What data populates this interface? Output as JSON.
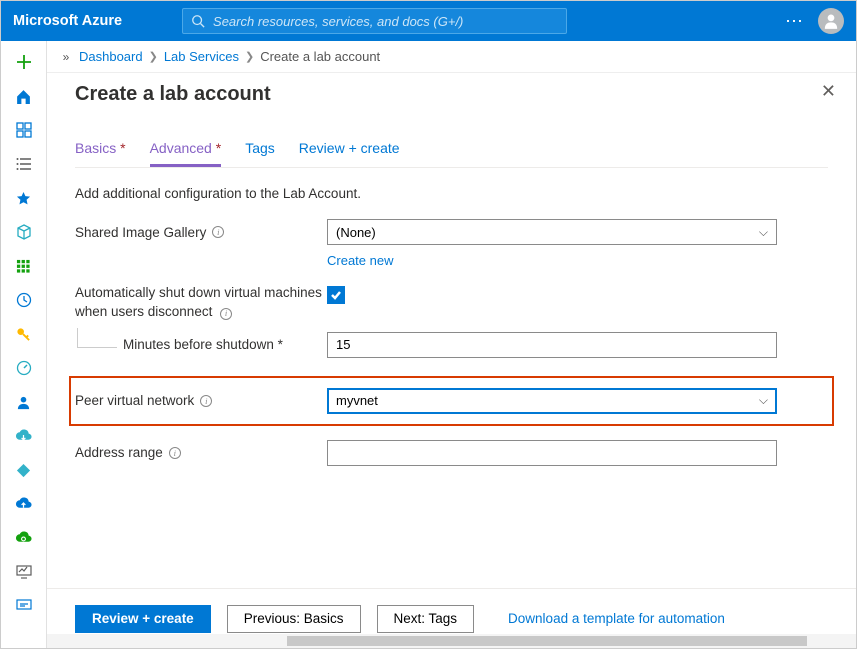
{
  "brand": "Microsoft Azure",
  "search": {
    "placeholder": "Search resources, services, and docs (G+/)"
  },
  "breadcrumb": {
    "items": [
      "Dashboard",
      "Lab Services",
      "Create a lab account"
    ]
  },
  "page": {
    "title": "Create a lab account",
    "description": "Add additional configuration to the Lab Account."
  },
  "tabs": [
    {
      "label": "Basics",
      "required": true
    },
    {
      "label": "Advanced",
      "required": true,
      "active": true
    },
    {
      "label": "Tags",
      "required": false
    },
    {
      "label": "Review + create",
      "required": false
    }
  ],
  "form": {
    "shared_gallery_label": "Shared Image Gallery",
    "shared_gallery_value": "(None)",
    "create_new": "Create new",
    "auto_shutdown_label": "Automatically shut down virtual machines when users disconnect",
    "auto_shutdown_checked": true,
    "minutes_label": "Minutes before shutdown",
    "minutes_value": "15",
    "peer_vnet_label": "Peer virtual network",
    "peer_vnet_value": "myvnet",
    "address_range_label": "Address range",
    "address_range_value": ""
  },
  "footer": {
    "review": "Review + create",
    "prev": "Previous: Basics",
    "next": "Next: Tags",
    "download": "Download a template for automation"
  }
}
